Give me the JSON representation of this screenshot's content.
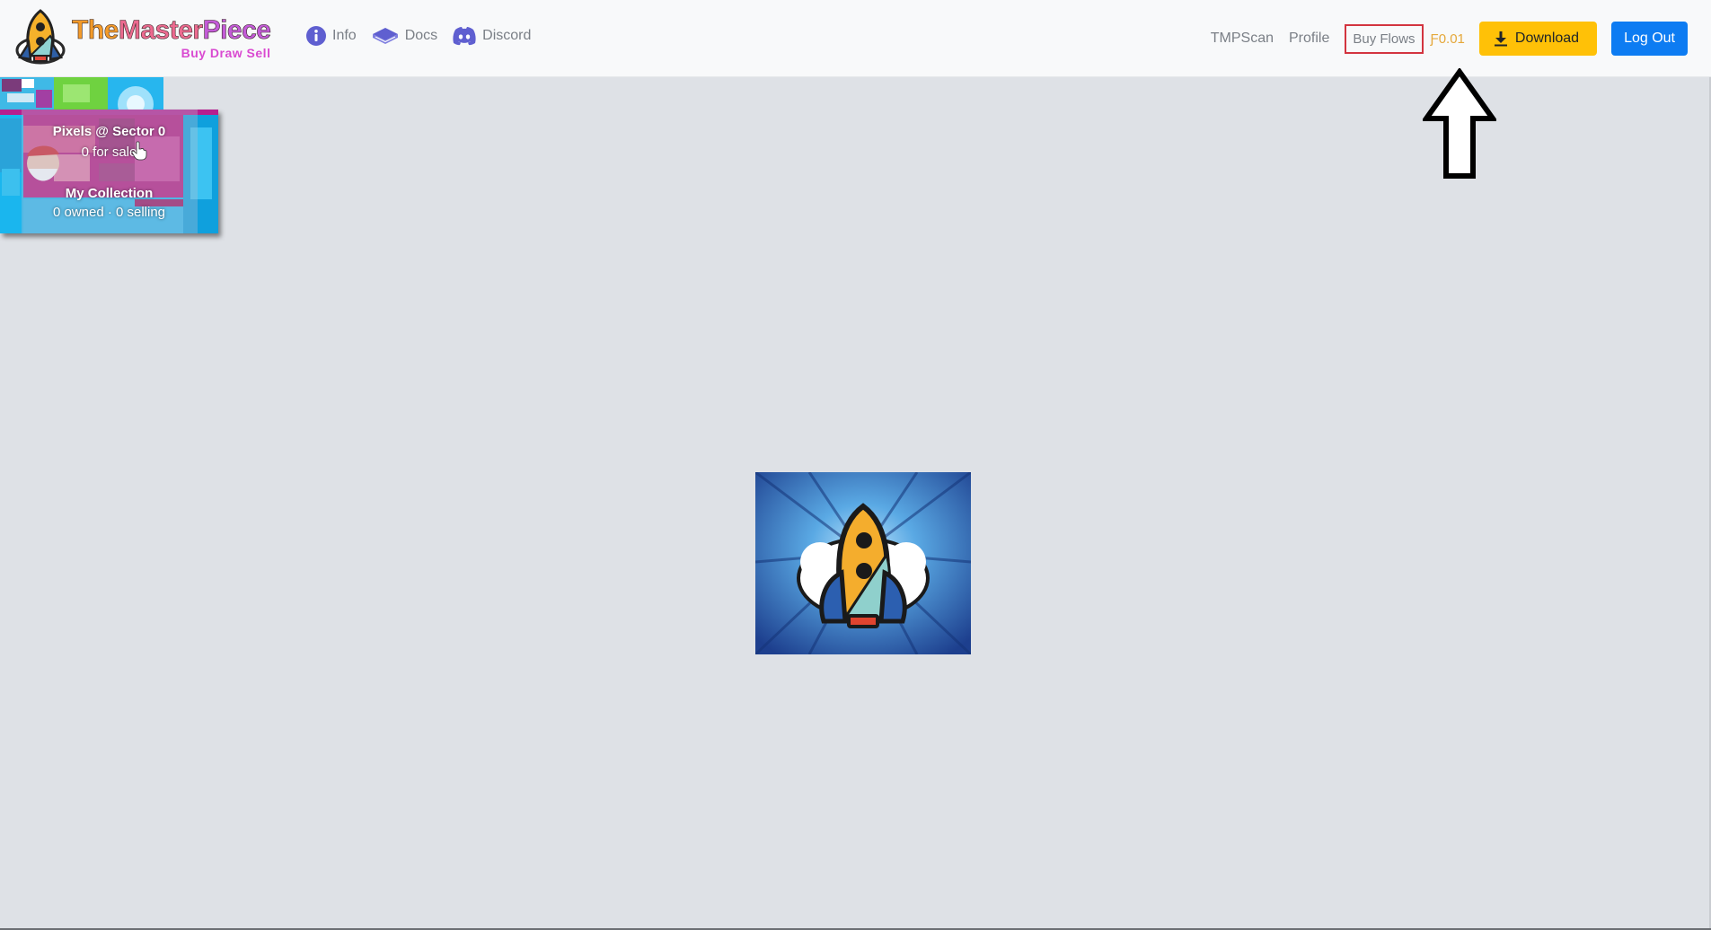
{
  "brand": {
    "name_part1": "The",
    "name_part2": "Master",
    "name_part3": "Piece",
    "tagline": "Buy Draw Sell",
    "logo_icon": "rocket-icon"
  },
  "nav_left": [
    {
      "label": "Info",
      "icon": "info-icon"
    },
    {
      "label": "Docs",
      "icon": "book-icon"
    },
    {
      "label": "Discord",
      "icon": "discord-icon"
    }
  ],
  "nav_right": {
    "tmpscan": "TMPScan",
    "profile": "Profile",
    "buy_flows": "Buy Flows",
    "balance": "Ƒ0.01",
    "download": "Download",
    "logout": "Log Out"
  },
  "panel": {
    "sector_title": "Pixels @ Sector 0",
    "for_sale": "0 for sale",
    "collection_title": "My Collection",
    "collection_stats": "0 owned · 0 selling"
  },
  "colors": {
    "navbar_bg": "#f8f9fa",
    "page_bg": "#dee1e6",
    "download_btn": "#ffc107",
    "logout_btn": "#0d7cf2",
    "highlight_border": "#d3343f",
    "balance_text": "#e5a83a",
    "icon_purple": "#5f5fd0"
  }
}
